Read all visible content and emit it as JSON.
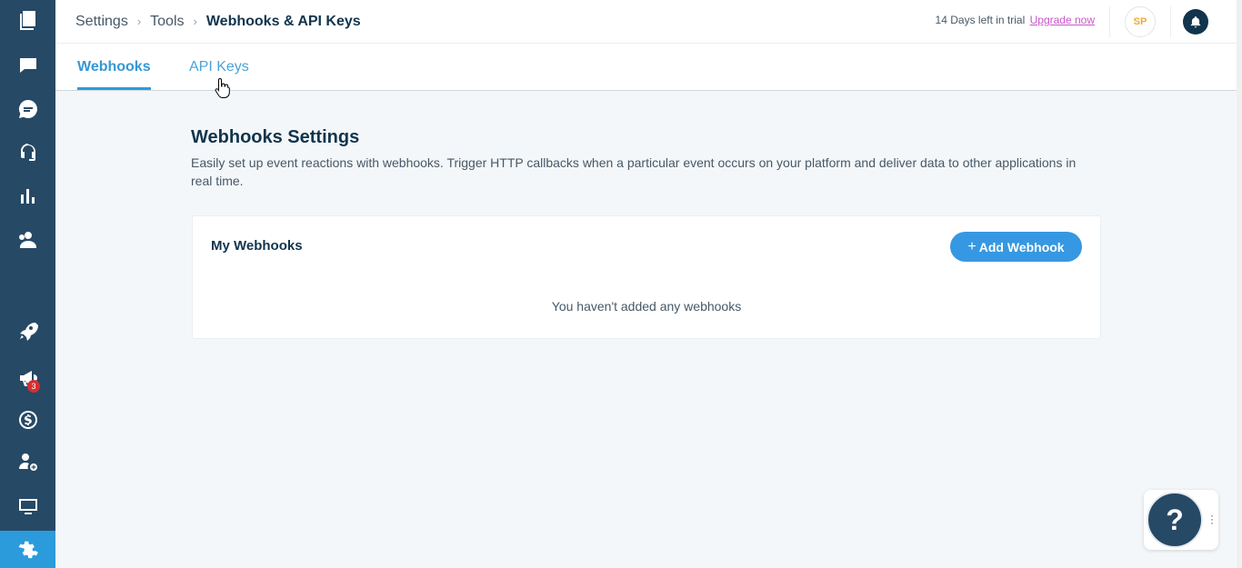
{
  "breadcrumb": {
    "level1": "Settings",
    "level2": "Tools",
    "current": "Webhooks & API Keys",
    "separator": "›"
  },
  "header": {
    "trial_text": "14 Days left in trial",
    "upgrade_label": "Upgrade now",
    "avatar_initials": "SP"
  },
  "tabs": [
    {
      "label": "Webhooks",
      "active": true
    },
    {
      "label": "API Keys",
      "active": false
    }
  ],
  "page": {
    "title": "Webhooks Settings",
    "description": "Easily set up event reactions with webhooks. Trigger HTTP callbacks when a particular event occurs on your platform and deliver data to other applications in real time."
  },
  "card": {
    "title": "My Webhooks",
    "add_button_label": "Add Webhook",
    "add_button_icon": "+",
    "empty_text": "You haven't added any webhooks"
  },
  "sidebar": {
    "items": [
      {
        "name": "solutions-icon"
      },
      {
        "name": "tickets-icon"
      },
      {
        "name": "chat-icon"
      },
      {
        "name": "headset-icon"
      },
      {
        "name": "analytics-icon"
      },
      {
        "name": "contacts-icon"
      },
      {
        "name": "rocket-icon"
      },
      {
        "name": "megaphone-icon",
        "badge": "3"
      },
      {
        "name": "billing-icon"
      },
      {
        "name": "add-agent-icon"
      },
      {
        "name": "monitor-icon"
      },
      {
        "name": "settings-icon",
        "active": true
      }
    ]
  },
  "help": {
    "label": "?"
  },
  "colors": {
    "sidebar": "#264966",
    "accent": "#2c9bdc",
    "text": "#12344d"
  }
}
